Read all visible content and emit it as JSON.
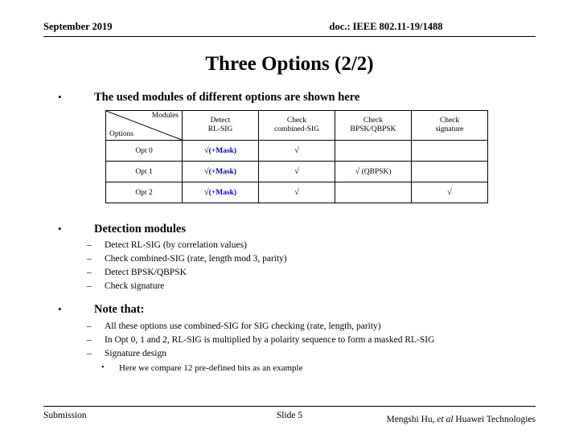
{
  "header": {
    "date": "September 2019",
    "doc": "doc.: IEEE 802.11-19/1488"
  },
  "title": "Three Options (2/2)",
  "intro_bullet": "The used modules of different options are shown here",
  "table": {
    "corner_row_label": "Options",
    "corner_col_label": "Modules",
    "columns": [
      "Detect\nRL-SIG",
      "Check\ncombined-SIG",
      "Check\nBPSK/QBPSK",
      "Check\nsignature"
    ],
    "columns_flat": [
      [
        "Detect",
        "RL-SIG"
      ],
      [
        "Check",
        "combined-SIG"
      ],
      [
        "Check",
        "BPSK/QBPSK"
      ],
      [
        "Check",
        "signature"
      ]
    ],
    "rows": [
      {
        "option": "Opt 0",
        "cells": [
          {
            "check": "√",
            "note": "(+Mask)",
            "note_highlight": true
          },
          {
            "check": "√",
            "note": "",
            "note_highlight": false
          },
          {
            "check": "",
            "note": "",
            "note_highlight": false
          },
          {
            "check": "",
            "note": "",
            "note_highlight": false
          }
        ]
      },
      {
        "option": "Opt 1",
        "cells": [
          {
            "check": "√",
            "note": "(+Mask)",
            "note_highlight": true
          },
          {
            "check": "√",
            "note": "",
            "note_highlight": false
          },
          {
            "check": "√",
            "note": "(QBPSK)",
            "note_highlight": false
          },
          {
            "check": "",
            "note": "",
            "note_highlight": false
          }
        ]
      },
      {
        "option": "Opt 2",
        "cells": [
          {
            "check": "√",
            "note": "(+Mask)",
            "note_highlight": true
          },
          {
            "check": "√",
            "note": "",
            "note_highlight": false
          },
          {
            "check": "",
            "note": "",
            "note_highlight": false
          },
          {
            "check": "√",
            "note": "",
            "note_highlight": false
          }
        ]
      }
    ]
  },
  "sections": [
    {
      "heading": "Detection modules",
      "items": [
        "Detect RL-SIG (by correlation values)",
        "Check combined-SIG (rate, length mod 3, parity)",
        "Detect BPSK/QBPSK",
        "Check signature"
      ],
      "subitems": []
    },
    {
      "heading": "Note that:",
      "items": [
        "All these options use combined-SIG for SIG checking (rate, length, parity)",
        "In Opt 0, 1 and 2, RL-SIG is multiplied by a polarity sequence to form a masked RL-SIG",
        "Signature design"
      ],
      "subitems": [
        "Here we compare 12 pre-defined bits as an example"
      ]
    }
  ],
  "footer": {
    "left": "Submission",
    "center": "Slide 5",
    "right_plain_1": "Mengshi Hu, ",
    "right_italic": "et al",
    "right_plain_2": " Huawei Technologies"
  },
  "colors": {
    "mask_highlight": "#0000cc",
    "text": "#000000",
    "background": "#ffffff"
  }
}
